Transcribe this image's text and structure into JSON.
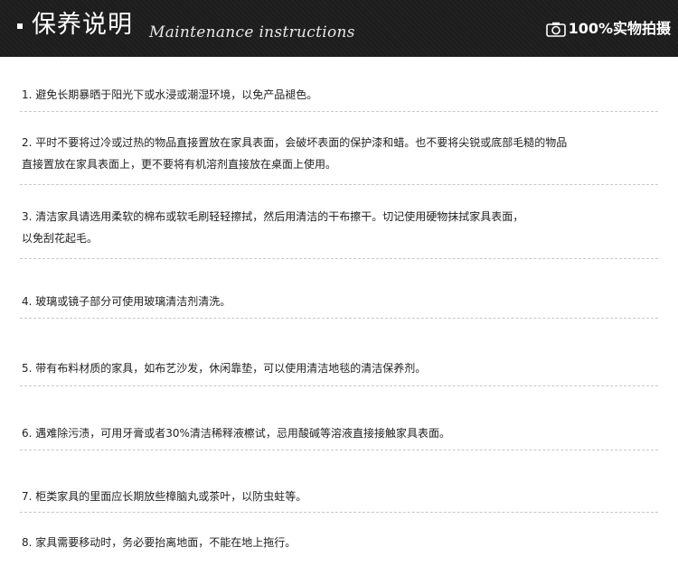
{
  "header": {
    "title": "保养说明",
    "subtitle": "Maintenance instructions",
    "photo_badge": "100%实物拍摄",
    "photo_icon": "camera-icon",
    "bg_color": "#1d1d1d"
  },
  "items": [
    {
      "line1": "1. 避免长期暴晒于阳光下或水浸或潮湿环境，以免产品褪色。"
    },
    {
      "line1": "2. 平时不要将过冷或过热的物品直接置放在家具表面，会破坏表面的保护漆和蜡。也不要将尖锐或底部毛糙的物品",
      "line2": "直接置放在家具表面上，更不要将有机溶剂直接放在桌面上使用。"
    },
    {
      "line1": "3. 清洁家具请选用柔软的棉布或软毛刷轻轻擦拭，然后用清洁的干布擦干。切记使用硬物抹拭家具表面，",
      "line2": "以免刮花起毛。"
    },
    {
      "line1": "4. 玻璃或镜子部分可使用玻璃清洁剂清洗。"
    },
    {
      "line1": "5. 带有布料材质的家具，如布艺沙发，休闲靠垫，可以使用清洁地毯的清洁保养剂。"
    },
    {
      "line1": "6. 遇难除污渍，可用牙膏或者30%清洁稀释液檫试，忌用酸碱等溶液直接接触家具表面。"
    },
    {
      "line1": "7. 柜类家具的里面应长期放些樟脑丸或茶叶，以防虫蛀等。"
    },
    {
      "line1": "8. 家具需要移动时，务必要抬离地面，不能在地上拖行。"
    }
  ]
}
